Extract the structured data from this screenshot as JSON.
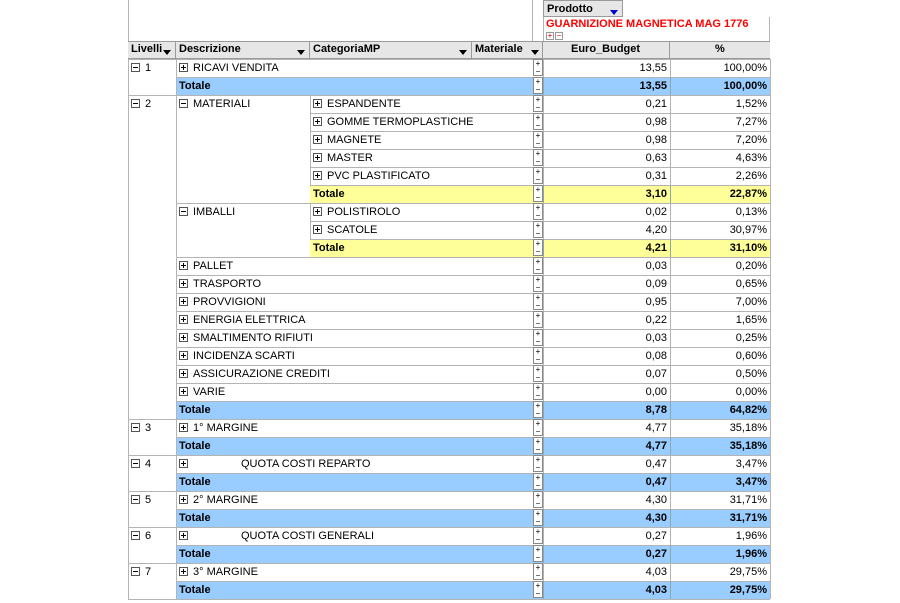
{
  "page_filter": {
    "label": "Prodotto",
    "value": "GUARNIZIONE MAGNETICA MAG 1776",
    "expand_plus": "+",
    "expand_minus": "−"
  },
  "columns": {
    "livelli": "Livelli",
    "descrizione": "Descrizione",
    "categoria": "CategoriaMP",
    "materiale": "Materiale",
    "euro_budget": "Euro_Budget",
    "pct": "%"
  },
  "colors": {
    "header_bg": "#e6e6e6",
    "total_blue": "#99ccff",
    "total_yellow": "#ffff99",
    "filter_red": "#ff0000",
    "arrow_blue": "#0000cc"
  },
  "rows": [
    {
      "type": "data",
      "level": "1",
      "desc": "RICAVI VENDITA",
      "cat": "",
      "euro": "13,55",
      "pct": "100,00%"
    },
    {
      "type": "total_blue",
      "label": "Totale",
      "euro": "13,55",
      "pct": "100,00%"
    },
    {
      "type": "data",
      "level": "2",
      "desc": "MATERIALI",
      "desc_icon": "minus",
      "cat": "ESPANDENTE",
      "euro": "0,21",
      "pct": "1,52%"
    },
    {
      "type": "data",
      "cat": "GOMME TERMOPLASTICHE",
      "euro": "0,98",
      "pct": "7,27%"
    },
    {
      "type": "data",
      "cat": "MAGNETE",
      "euro": "0,98",
      "pct": "7,20%"
    },
    {
      "type": "data",
      "cat": "MASTER",
      "euro": "0,63",
      "pct": "4,63%"
    },
    {
      "type": "data",
      "cat": "PVC PLASTIFICATO",
      "euro": "0,31",
      "pct": "2,26%"
    },
    {
      "type": "total_yellow",
      "label": "Totale",
      "euro": "3,10",
      "pct": "22,87%"
    },
    {
      "type": "data",
      "desc": "IMBALLI",
      "desc_icon": "minus",
      "cat": "POLISTIROLO",
      "euro": "0,02",
      "pct": "0,13%"
    },
    {
      "type": "data",
      "cat": "SCATOLE",
      "euro": "4,20",
      "pct": "30,97%"
    },
    {
      "type": "total_yellow",
      "label": "Totale",
      "euro": "4,21",
      "pct": "31,10%"
    },
    {
      "type": "data",
      "desc": "PALLET",
      "euro": "0,03",
      "pct": "0,20%"
    },
    {
      "type": "data",
      "desc": "TRASPORTO",
      "euro": "0,09",
      "pct": "0,65%"
    },
    {
      "type": "data",
      "desc": "PROVVIGIONI",
      "euro": "0,95",
      "pct": "7,00%"
    },
    {
      "type": "data",
      "desc": "ENERGIA ELETTRICA",
      "euro": "0,22",
      "pct": "1,65%"
    },
    {
      "type": "data",
      "desc": "SMALTIMENTO RIFIUTI",
      "euro": "0,03",
      "pct": "0,25%"
    },
    {
      "type": "data",
      "desc": "INCIDENZA SCARTI",
      "euro": "0,08",
      "pct": "0,60%"
    },
    {
      "type": "data",
      "desc": "ASSICURAZIONE CREDITI",
      "euro": "0,07",
      "pct": "0,50%"
    },
    {
      "type": "data",
      "desc": "VARIE",
      "euro": "0,00",
      "pct": "0,00%"
    },
    {
      "type": "total_blue",
      "label": "Totale",
      "euro": "8,78",
      "pct": "64,82%"
    },
    {
      "type": "data",
      "level": "3",
      "desc": "1° MARGINE",
      "euro": "4,77",
      "pct": "35,18%"
    },
    {
      "type": "total_blue",
      "label": "Totale",
      "euro": "4,77",
      "pct": "35,18%"
    },
    {
      "type": "data",
      "level": "4",
      "desc": "",
      "desc_far": "QUOTA COSTI REPARTO",
      "euro": "0,47",
      "pct": "3,47%"
    },
    {
      "type": "total_blue",
      "label": "Totale",
      "euro": "0,47",
      "pct": "3,47%"
    },
    {
      "type": "data",
      "level": "5",
      "desc": "2° MARGINE",
      "euro": "4,30",
      "pct": "31,71%"
    },
    {
      "type": "total_blue",
      "label": "Totale",
      "euro": "4,30",
      "pct": "31,71%"
    },
    {
      "type": "data",
      "level": "6",
      "desc": "",
      "desc_far": "QUOTA COSTI GENERALI",
      "euro": "0,27",
      "pct": "1,96%"
    },
    {
      "type": "total_blue",
      "label": "Totale",
      "euro": "0,27",
      "pct": "1,96%"
    },
    {
      "type": "data",
      "level": "7",
      "desc": "3° MARGINE",
      "euro": "4,03",
      "pct": "29,75%"
    },
    {
      "type": "total_blue",
      "label": "Totale",
      "euro": "4,03",
      "pct": "29,75%"
    }
  ]
}
